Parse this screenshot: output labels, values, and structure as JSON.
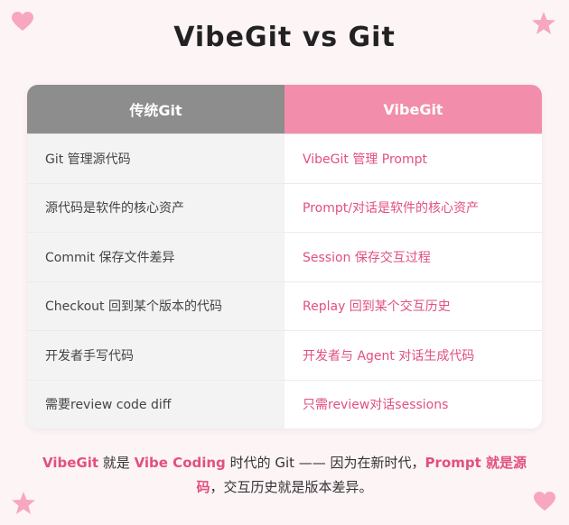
{
  "title": "VibeGit vs Git",
  "table": {
    "headers": {
      "git": "传统Git",
      "vibe": "VibeGit"
    },
    "rows": [
      {
        "git": "Git 管理源代码",
        "vibe": "VibeGit 管理 Prompt"
      },
      {
        "git": "源代码是软件的核心资产",
        "vibe": "Prompt/对话是软件的核心资产"
      },
      {
        "git": "Commit 保存文件差异",
        "vibe": "Session 保存交互过程"
      },
      {
        "git": "Checkout 回到某个版本的代码",
        "vibe": "Replay 回到某个交互历史"
      },
      {
        "git": "开发者手写代码",
        "vibe": "开发者与 Agent 对话生成代码"
      },
      {
        "git": "需要review code diff",
        "vibe": "只需review对话sessions"
      }
    ]
  },
  "footer": {
    "p1": "VibeGit",
    "p2": " 就是 ",
    "p3": "Vibe Coding",
    "p4": " 时代的 Git —— 因为在新时代，",
    "p5": "Prompt 就是源码",
    "p6": "，交互历史就是版本差异。"
  },
  "colors": {
    "accent": "#e2507e",
    "header_git": "#8d8d8d",
    "header_vibe": "#f28dab"
  },
  "decorations": [
    "heart-icon",
    "star-icon",
    "star-icon",
    "heart-icon"
  ]
}
